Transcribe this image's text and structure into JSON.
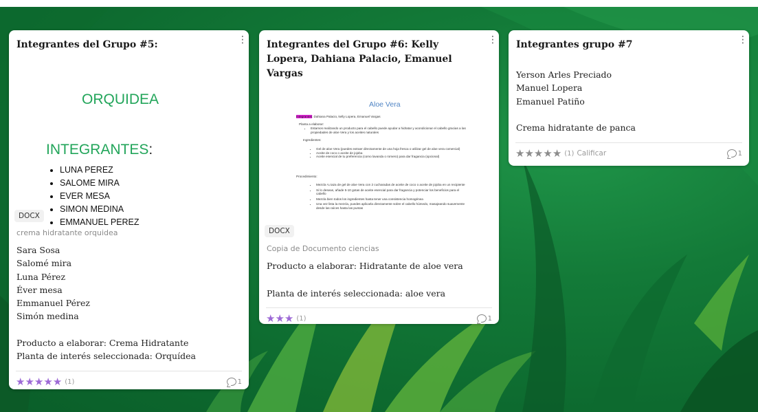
{
  "colors": {
    "board_green": "#137a38",
    "star_purple": "#9d6ad6",
    "star_gray": "#8c8c8c",
    "orquidea_green": "#22a55a",
    "aloe_blue": "#4f84c4",
    "highlight_magenta": "#e020d8"
  },
  "cards": [
    {
      "title": "Integrantes del Grupo #5:",
      "attachment": {
        "heading": "ORQUIDEA",
        "subheading": "INTEGRANTES",
        "subheading_colon": ":",
        "bullets": [
          "LUNA PEREZ",
          "SALOME MIRA",
          "EVER MESA",
          "SIMON MEDINA",
          "EMMANUEL PEREZ"
        ],
        "type": "DOCX",
        "caption": "crema hidratante orquidea"
      },
      "body_lines": [
        "Sara Sosa",
        "Salomé mira",
        "Luna Pérez",
        "Éver mesa",
        "Emmanuel Pérez",
        "Simón medina",
        "",
        "Producto a elaborar: Crema Hidratante",
        "Planta de interés seleccionada: Orquídea"
      ],
      "rating": {
        "stars": 5,
        "count": "(1)"
      },
      "comments": "1",
      "menu_icon": "kebab-icon"
    },
    {
      "title": "Integrantes del Grupo #6: Kelly Lopera, Dahiana Palacio, Emanuel Vargas",
      "attachment": {
        "doc_title": "Aloe Vera",
        "doc_lines": {
          "integrantes_label": "Integrantes",
          "integrantes_text": ": Dahiana Palacio, kelly Lopera, Emanuel Vargas",
          "planta_label": "Planta a elaborar:",
          "planta_bullet": "Estamos realizando un producto para el cabello puede ayudar a hidratar y acondicionar el cabello gracias a las propiedades de aloe Vera y los aceites naturales",
          "ingredientes_label": "Ingredientes:",
          "ingredientes": [
            "Gel de aloe Vera (puedes extraer directamente de una hoja fresca o utilizar gel de aloe vera comercial)",
            "Aceite de coco o aceite de jojoba",
            "Aceite esencial de tu preferencia (como lavanda o romero) para dar fragancia (opcional)"
          ],
          "procedimiento_label": "Procedimiento:",
          "procedimiento": [
            "Mezcla ¼ taza de gel de aloe Vera con 2 cucharadas de aceite de coco o aceite de jojoba en un recipiente",
            "Si lo deseas, añade 5-10 gotas de aceite esencial para dar fragancia y potenciar los beneficios para el cabello",
            "Mezcla bien todos los ingredientes hasta tener una consistencia homogénea",
            "Una vez lista la mezcla, puedes aplicarla directamente sobre el cabello húmedo, masajeando suavemente desde las raíces hasta las puntas"
          ]
        },
        "type": "DOCX",
        "caption": "Copia de Documento ciencias"
      },
      "body_lines": [
        "Producto a elaborar: Hidratante de aloe vera",
        "",
        "Planta de interés seleccionada: aloe vera"
      ],
      "rating": {
        "stars": 3,
        "count": "(1)"
      },
      "comments": "1",
      "menu_icon": "kebab-icon"
    },
    {
      "title": "Integrantes grupo #7",
      "body_lines": [
        "Yerson Arles Preciado",
        "Manuel Lopera",
        "Emanuel Patiño",
        "",
        "Crema hidratante de panca"
      ],
      "rating": {
        "stars": 5,
        "count": "(1)",
        "action": "Calificar"
      },
      "comments": "1",
      "menu_icon": "kebab-icon"
    }
  ]
}
